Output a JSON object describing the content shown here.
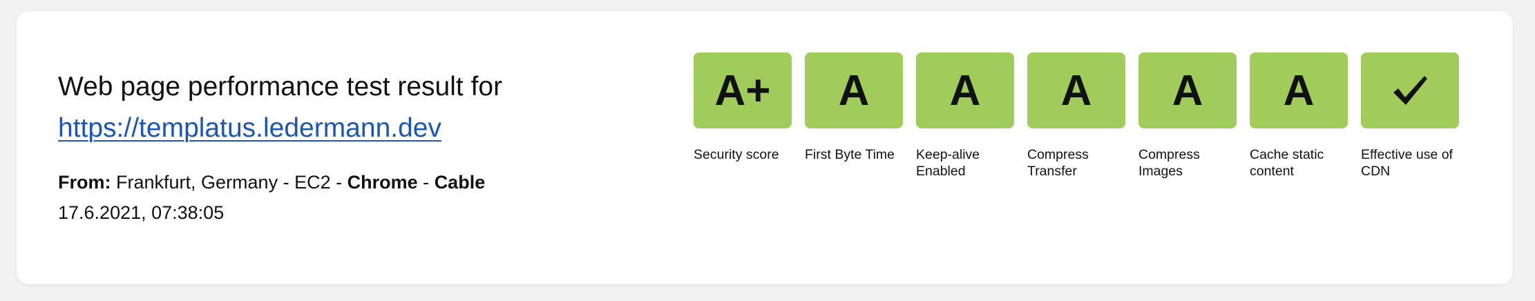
{
  "header": {
    "title": "Web page performance test result for",
    "url": "https://templatus.ledermann.dev"
  },
  "test_info": {
    "from_label": "From:",
    "location": "Frankfurt, Germany - EC2",
    "separator": "-",
    "browser": "Chrome",
    "connection": "Cable",
    "timestamp": "17.6.2021, 07:38:05"
  },
  "grades": [
    {
      "grade": "A+",
      "label": "Security score"
    },
    {
      "grade": "A",
      "label": "First Byte Time"
    },
    {
      "grade": "A",
      "label": "Keep-alive Enabled"
    },
    {
      "grade": "A",
      "label": "Compress Transfer"
    },
    {
      "grade": "A",
      "label": "Compress Images"
    },
    {
      "grade": "A",
      "label": "Cache static content"
    },
    {
      "grade": "✓",
      "label": "Effective use of CDN",
      "icon": "checkmark-icon"
    }
  ],
  "colors": {
    "grade_background": "#a0cc5a",
    "link": "#1a56b8",
    "page_background": "#f2f2f2",
    "card_background": "#ffffff"
  }
}
